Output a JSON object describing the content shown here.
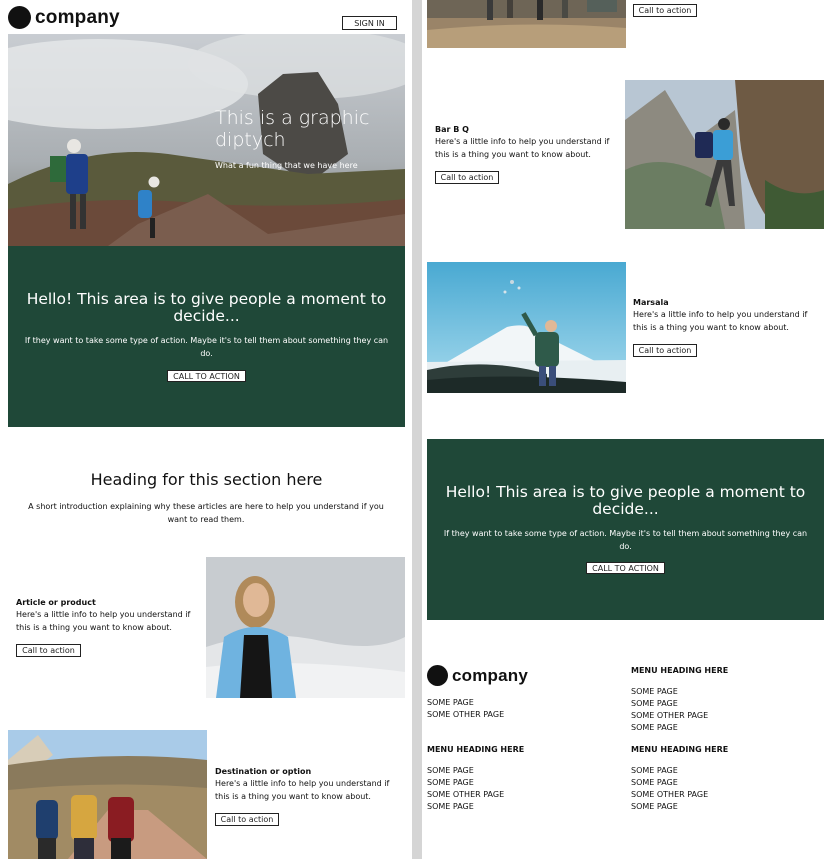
{
  "brand": {
    "name": "company"
  },
  "header": {
    "sign_in": "SIGN IN"
  },
  "hero": {
    "title": "This is a graphic diptych",
    "subtitle": "What a fun thing that we have here"
  },
  "cta_banner": {
    "heading": "Hello! This area is to give people a moment to decide...",
    "text": "If they want to take some type of action. Maybe it's to tell them about something they can do.",
    "button": "CALL TO ACTION"
  },
  "section": {
    "heading": "Heading for this section here",
    "intro": "A short introduction explaining why these articles are here to help you understand if you want to read them."
  },
  "cards": [
    {
      "title": "Article or product",
      "body": "Here's a little info to help you understand if this is a thing you want to know about.",
      "button": "Call to action"
    },
    {
      "title": "Destination or option",
      "body": "Here's a little info to help you understand if this is a thing you want to know about.",
      "button": "Call to action"
    },
    {
      "title": "Bar B Q",
      "body": "Here's a little info to help you understand if this is a thing you want to know about.",
      "button": "Call to action"
    },
    {
      "title": "Marsala",
      "body": "Here's a little info to help you understand if this is a thing you want to know about.",
      "button": "Call to action"
    }
  ],
  "top_partial_button": "Call to action",
  "footer": {
    "links_main": [
      "SOME PAGE",
      "SOME OTHER PAGE"
    ],
    "menus": [
      {
        "heading": "MENU HEADING HERE",
        "items": [
          "SOME PAGE",
          "SOME PAGE",
          "SOME OTHER PAGE",
          "SOME PAGE"
        ]
      },
      {
        "heading": "MENU HEADING HERE",
        "items": [
          "SOME PAGE",
          "SOME PAGE",
          "SOME OTHER PAGE",
          "SOME PAGE"
        ]
      },
      {
        "heading": "MENU HEADING HERE",
        "items": [
          "SOME PAGE",
          "SOME PAGE",
          "SOME OTHER PAGE",
          "SOME PAGE"
        ]
      }
    ]
  },
  "colors": {
    "banner_green": "#1f4838",
    "gutter": "#d5d5d5"
  }
}
